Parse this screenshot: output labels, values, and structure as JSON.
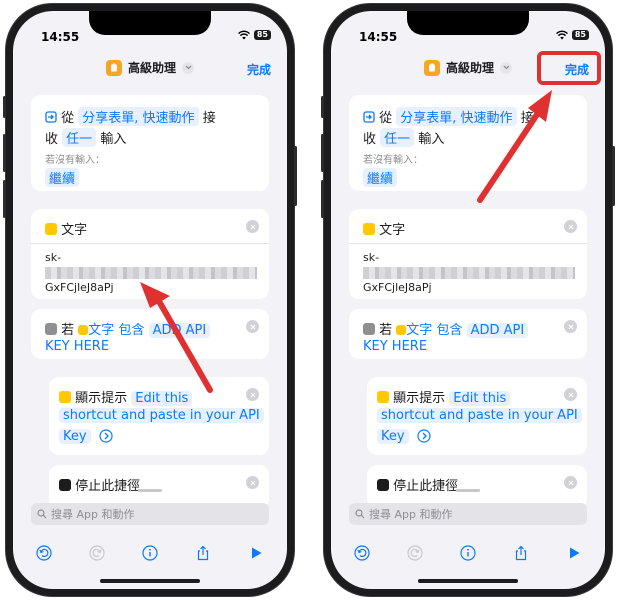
{
  "status": {
    "time": "14:55",
    "battery": "85"
  },
  "nav": {
    "title": "高級助理",
    "done": "完成"
  },
  "receive": {
    "prefix": "從",
    "sources": "分享表單, 快速動作",
    "suffix1": "接",
    "line2_prefix": "收",
    "any": "任一",
    "line2_suffix": "輸入",
    "no_input_label": "若沒有輸入：",
    "continue": "繼續"
  },
  "text_action": {
    "title": "文字",
    "line1": "sk-",
    "line3": "GxFCjleJ8aPj"
  },
  "if_action": {
    "keyword": "若",
    "var": "文字",
    "op": "包含",
    "value_part1": "ADD API",
    "value_part2": "KEY HERE"
  },
  "alert_action": {
    "title": "顯示提示",
    "text1": "Edit this",
    "text2": "shortcut and paste in your API",
    "text3": "Key"
  },
  "stop_action": {
    "title": "停止此捷徑"
  },
  "search": {
    "placeholder": "搜尋 App 和動作"
  },
  "colors": {
    "accent": "#0a7aff",
    "annotation": "#e03131",
    "app_icon": "#f5a623",
    "text_icon": "#ffc800",
    "if_icon": "#8e8e93",
    "stop_icon": "#1c1c1e"
  }
}
